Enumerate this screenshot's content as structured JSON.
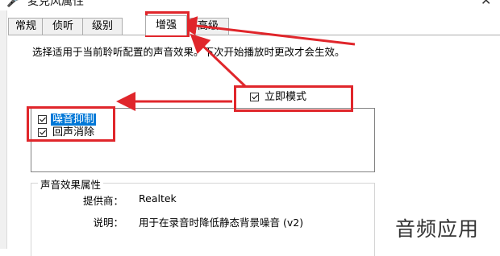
{
  "window": {
    "title": "麦克风属性",
    "close_glyph": "✕"
  },
  "tabs": [
    {
      "label": "常规",
      "active": false
    },
    {
      "label": "侦听",
      "active": false
    },
    {
      "label": "级别",
      "active": false
    },
    {
      "label": "增强",
      "active": true
    },
    {
      "label": "高级",
      "active": false
    }
  ],
  "description": "选择适用于当前聆听配置的声音效果。下次开始播放时更改才会生效。",
  "effects": [
    {
      "label": "噪音抑制",
      "checked": true,
      "selected": true
    },
    {
      "label": "回声消除",
      "checked": true,
      "selected": false
    }
  ],
  "immediate_mode": {
    "label": "立即模式",
    "checked": true
  },
  "properties": {
    "group_title": "声音效果属性",
    "provider_key": "提供商：",
    "provider_value": "Realtek",
    "desc_key": "说明：",
    "desc_value": "用于在录音时降低静态背景噪音 (v2)"
  },
  "watermark": "音频应用",
  "colors": {
    "annotation": "#e0262b",
    "selection": "#0078d7"
  }
}
